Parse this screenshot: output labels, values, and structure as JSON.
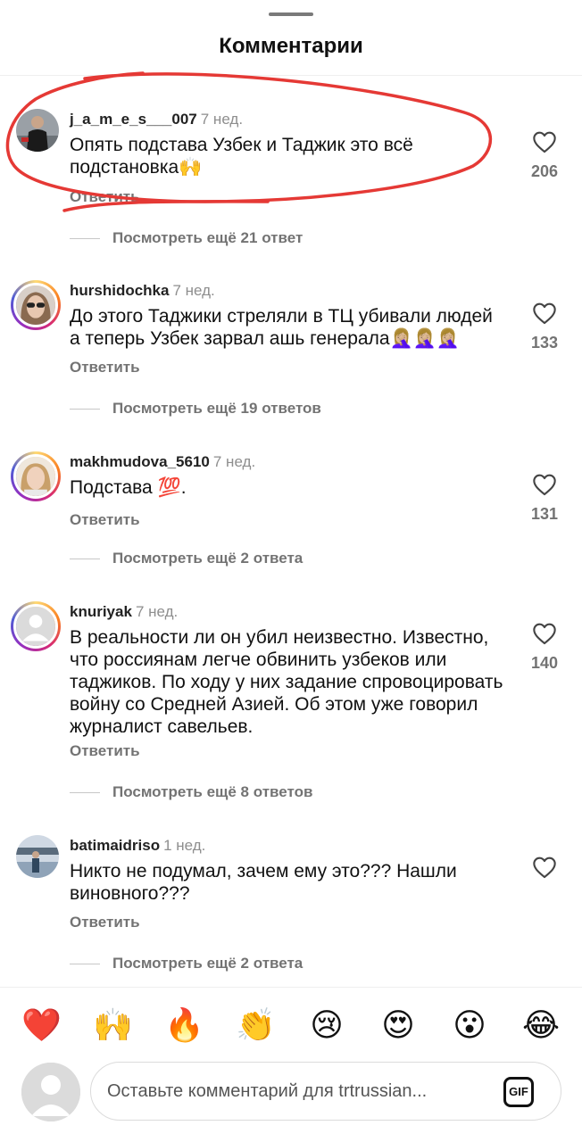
{
  "header": {
    "title": "Комментарии"
  },
  "comments": [
    {
      "username": "j_a_m_e_s___007",
      "time": "7 нед.",
      "text": "Опять подстава Узбек и Таджик это всё подстановка🙌",
      "reply": "Ответить",
      "more": "Посмотреть ещё 21 ответ",
      "likes": "206",
      "avatar": "man-black-shirt-photo"
    },
    {
      "username": "hurshidochka",
      "time": "7 нед.",
      "text": "До этого Таджики стреляли в ТЦ убивали людей а теперь Узбек зарвал ашь генерала🤦🏼‍♀️🤦🏼‍♀️🤦🏼‍♀️",
      "reply": "Ответить",
      "more": "Посмотреть ещё 19 ответов",
      "likes": "133",
      "avatar": "woman-sunglasses-photo"
    },
    {
      "username": "makhmudova_5610",
      "time": "7 нед.",
      "text": "Подстава 💯.",
      "reply": "Ответить",
      "more": "Посмотреть ещё 2 ответа",
      "likes": "131",
      "avatar": "woman-blonde-photo"
    },
    {
      "username": "knuriyak",
      "time": "7 нед.",
      "text": "В реальности ли он убил неизвестно. Известно, что россиянам легче обвинить узбеков или таджиков. По ходу у них задание спровоцировать войну со Средней Азией. Об этом уже говорил журналист савельев.",
      "reply": "Ответить",
      "more": "Посмотреть ещё 8 ответов",
      "likes": "140",
      "avatar": "default-person"
    },
    {
      "username": "batimaidriso",
      "time": "1 нед.",
      "text": "Никто не подумал, зачем ему это??? Нашли виновного???",
      "reply": "Ответить",
      "more": "Посмотреть ещё 2 ответа",
      "likes": "",
      "avatar": "person-outdoor-photo"
    }
  ],
  "reactions": [
    "❤️",
    "🙌",
    "🔥",
    "👏",
    "😢",
    "😍",
    "😮",
    "😂"
  ],
  "composer": {
    "placeholder": "Оставьте комментарий для trtrussian...",
    "gif_label": "GIF"
  },
  "colors": {
    "annotation": "#e53935",
    "heart": "#ed4956",
    "text_secondary": "#737373"
  }
}
